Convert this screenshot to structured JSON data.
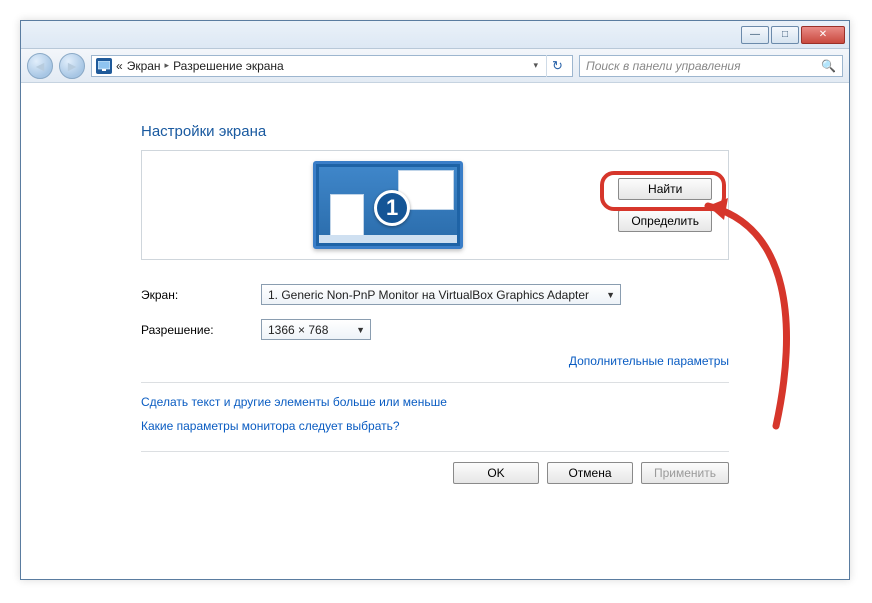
{
  "window": {
    "minimize": "—",
    "maximize": "□",
    "close": "✕"
  },
  "nav": {
    "back": "◄",
    "forward": "►",
    "crumb_prefix": "«",
    "crumb1": "Экран",
    "crumb2": "Разрешение экрана",
    "dropdown": "▾",
    "refresh": "↻"
  },
  "search": {
    "placeholder": "Поиск в панели управления",
    "icon": "🔍"
  },
  "heading": "Настройки экрана",
  "preview": {
    "monitor_number": "1",
    "find_button": "Найти",
    "identify_button": "Определить"
  },
  "form": {
    "screen_label": "Экран:",
    "screen_value": "1. Generic Non-PnP Monitor на VirtualBox Graphics Adapter",
    "resolution_label": "Разрешение:",
    "resolution_value": "1366 × 768"
  },
  "links": {
    "advanced": "Дополнительные параметры",
    "text_size": "Сделать текст и другие элементы больше или меньше",
    "which_params": "Какие параметры монитора следует выбрать?"
  },
  "footer": {
    "ok": "OK",
    "cancel": "Отмена",
    "apply": "Применить"
  },
  "annotation": {
    "color": "#d6362b"
  }
}
